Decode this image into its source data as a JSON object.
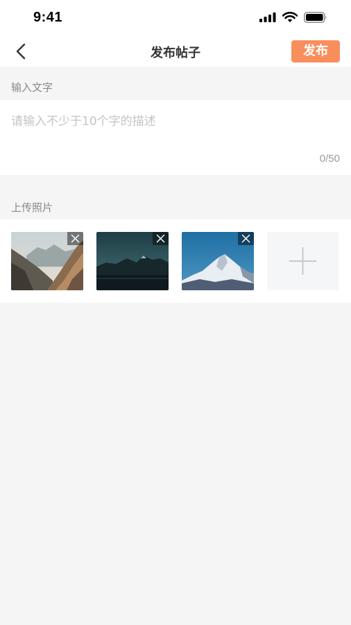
{
  "status_bar": {
    "time": "9:41"
  },
  "header": {
    "title": "发布帖子",
    "publish_label": "发布"
  },
  "text_section": {
    "label": "输入文字",
    "placeholder": "请输入不少于10个字的描述",
    "value": "",
    "char_count": "0/50"
  },
  "photo_section": {
    "label": "上传照片",
    "photos": [
      {
        "description": "rocky mountain ridge"
      },
      {
        "description": "dark mountain lake"
      },
      {
        "description": "snowy peak blue sky"
      }
    ]
  },
  "colors": {
    "accent": "#f98e5d",
    "background": "#f5f5f5",
    "card": "#ffffff"
  },
  "icons": {
    "back": "chevron-left-icon",
    "remove": "close-icon",
    "add": "plus-icon",
    "signal": "signal-icon",
    "wifi": "wifi-icon",
    "battery": "battery-icon"
  }
}
